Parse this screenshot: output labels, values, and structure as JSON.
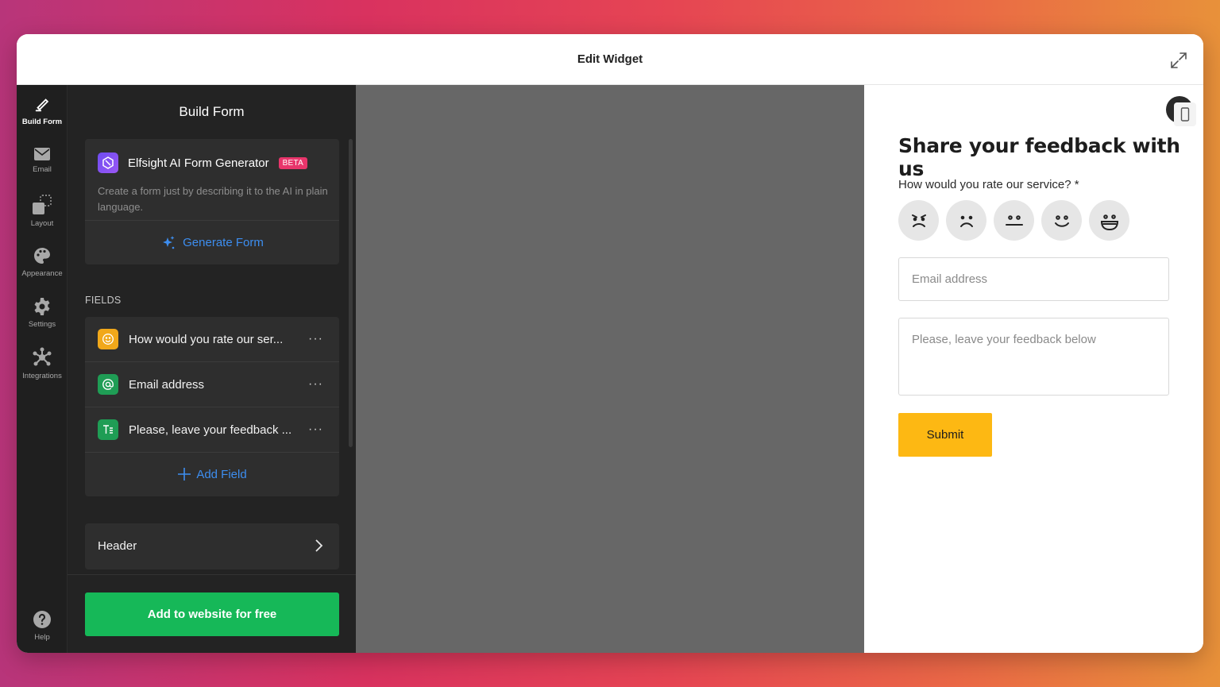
{
  "window": {
    "title": "Edit Widget"
  },
  "rail": {
    "items": [
      {
        "label": "Build Form",
        "icon": "pencil-icon"
      },
      {
        "label": "Email",
        "icon": "envelope-icon"
      },
      {
        "label": "Layout",
        "icon": "layout-icon"
      },
      {
        "label": "Appearance",
        "icon": "palette-icon"
      },
      {
        "label": "Settings",
        "icon": "gear-icon"
      },
      {
        "label": "Integrations",
        "icon": "integrations-icon"
      }
    ],
    "help": {
      "label": "Help",
      "icon": "help-icon"
    }
  },
  "panel": {
    "title": "Build Form",
    "ai": {
      "name": "Elfsight AI Form Generator",
      "badge": "BETA",
      "description": "Create a form just by describing it to the AI in plain language.",
      "button": "Generate Form"
    },
    "fields_label": "FIELDS",
    "fields": [
      {
        "label": "How would you rate our ser...",
        "icon": "smiley-icon",
        "more": "···"
      },
      {
        "label": "Email address",
        "icon": "at-icon",
        "more": "···"
      },
      {
        "label": "Please, leave your feedback ...",
        "icon": "textarea-icon",
        "more": "···"
      }
    ],
    "add_field": "Add Field",
    "header_section": "Header",
    "cta": "Add to website for free"
  },
  "preview": {
    "title": "Share your feedback with us",
    "rating_question": "How would you rate our service? *",
    "email_placeholder": "Email address",
    "feedback_placeholder": "Please, leave your feedback below",
    "submit": "Submit"
  },
  "colors": {
    "accent_blue": "#3d8ef0",
    "cta_green": "#16b858",
    "submit_yellow": "#fdb813",
    "beta_pink": "#e8356b"
  }
}
